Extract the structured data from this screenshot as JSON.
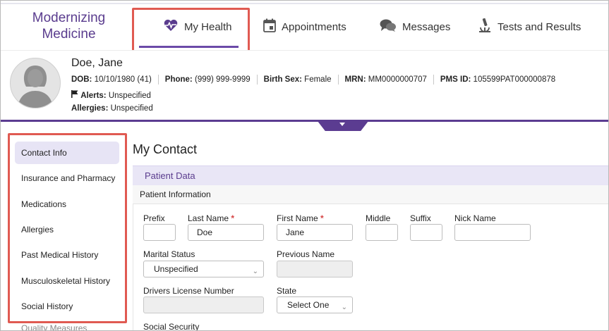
{
  "app": {
    "logo_line1": "Modernizing",
    "logo_line2": "Medicine"
  },
  "nav": {
    "tabs": [
      {
        "label": "My Health",
        "icon": "heart-pulse-icon",
        "active": true
      },
      {
        "label": "Appointments",
        "icon": "calendar-icon",
        "active": false
      },
      {
        "label": "Messages",
        "icon": "chat-bubbles-icon",
        "active": false
      },
      {
        "label": "Tests and Results",
        "icon": "microscope-icon",
        "active": false
      }
    ]
  },
  "patient": {
    "name": "Doe, Jane",
    "dob_label": "DOB:",
    "dob_value": "10/10/1980 (41)",
    "phone_label": "Phone:",
    "phone_value": "(999) 999-9999",
    "sex_label": "Birth Sex:",
    "sex_value": "Female",
    "mrn_label": "MRN:",
    "mrn_value": "MM0000000707",
    "pms_label": "PMS ID:",
    "pms_value": "105599PAT000000878",
    "alerts_label": "Alerts:",
    "alerts_value": "Unspecified",
    "allergies_label": "Allergies:",
    "allergies_value": "Unspecified"
  },
  "sidebar": {
    "items": [
      {
        "label": "Contact Info",
        "active": true
      },
      {
        "label": "Insurance and Pharmacy"
      },
      {
        "label": "Medications"
      },
      {
        "label": "Allergies"
      },
      {
        "label": "Past Medical History"
      },
      {
        "label": "Musculoskeletal History"
      },
      {
        "label": "Social History"
      },
      {
        "label": "Quality Measures"
      }
    ]
  },
  "main": {
    "title": "My Contact",
    "section": "Patient Data",
    "subsection": "Patient Information",
    "form": {
      "prefix_label": "Prefix",
      "prefix_value": "",
      "last_name_label": "Last Name",
      "last_name_value": "Doe",
      "first_name_label": "First Name",
      "first_name_value": "Jane",
      "middle_label": "Middle",
      "middle_value": "",
      "suffix_label": "Suffix",
      "suffix_value": "",
      "nick_label": "Nick Name",
      "nick_value": "",
      "marital_label": "Marital Status",
      "marital_value": "Unspecified",
      "previous_name_label": "Previous Name",
      "previous_name_value": "",
      "license_label": "Drivers License Number",
      "license_value": "",
      "state_label": "State",
      "state_value": "Select One",
      "ssn_label": "Social Security",
      "required_mark": "*"
    }
  },
  "colors": {
    "brand": "#5a3c8e",
    "accent_bar": "#5b3c91",
    "highlight": "#e05a52",
    "active_bg": "#e7e4f5",
    "required": "#d64545"
  }
}
